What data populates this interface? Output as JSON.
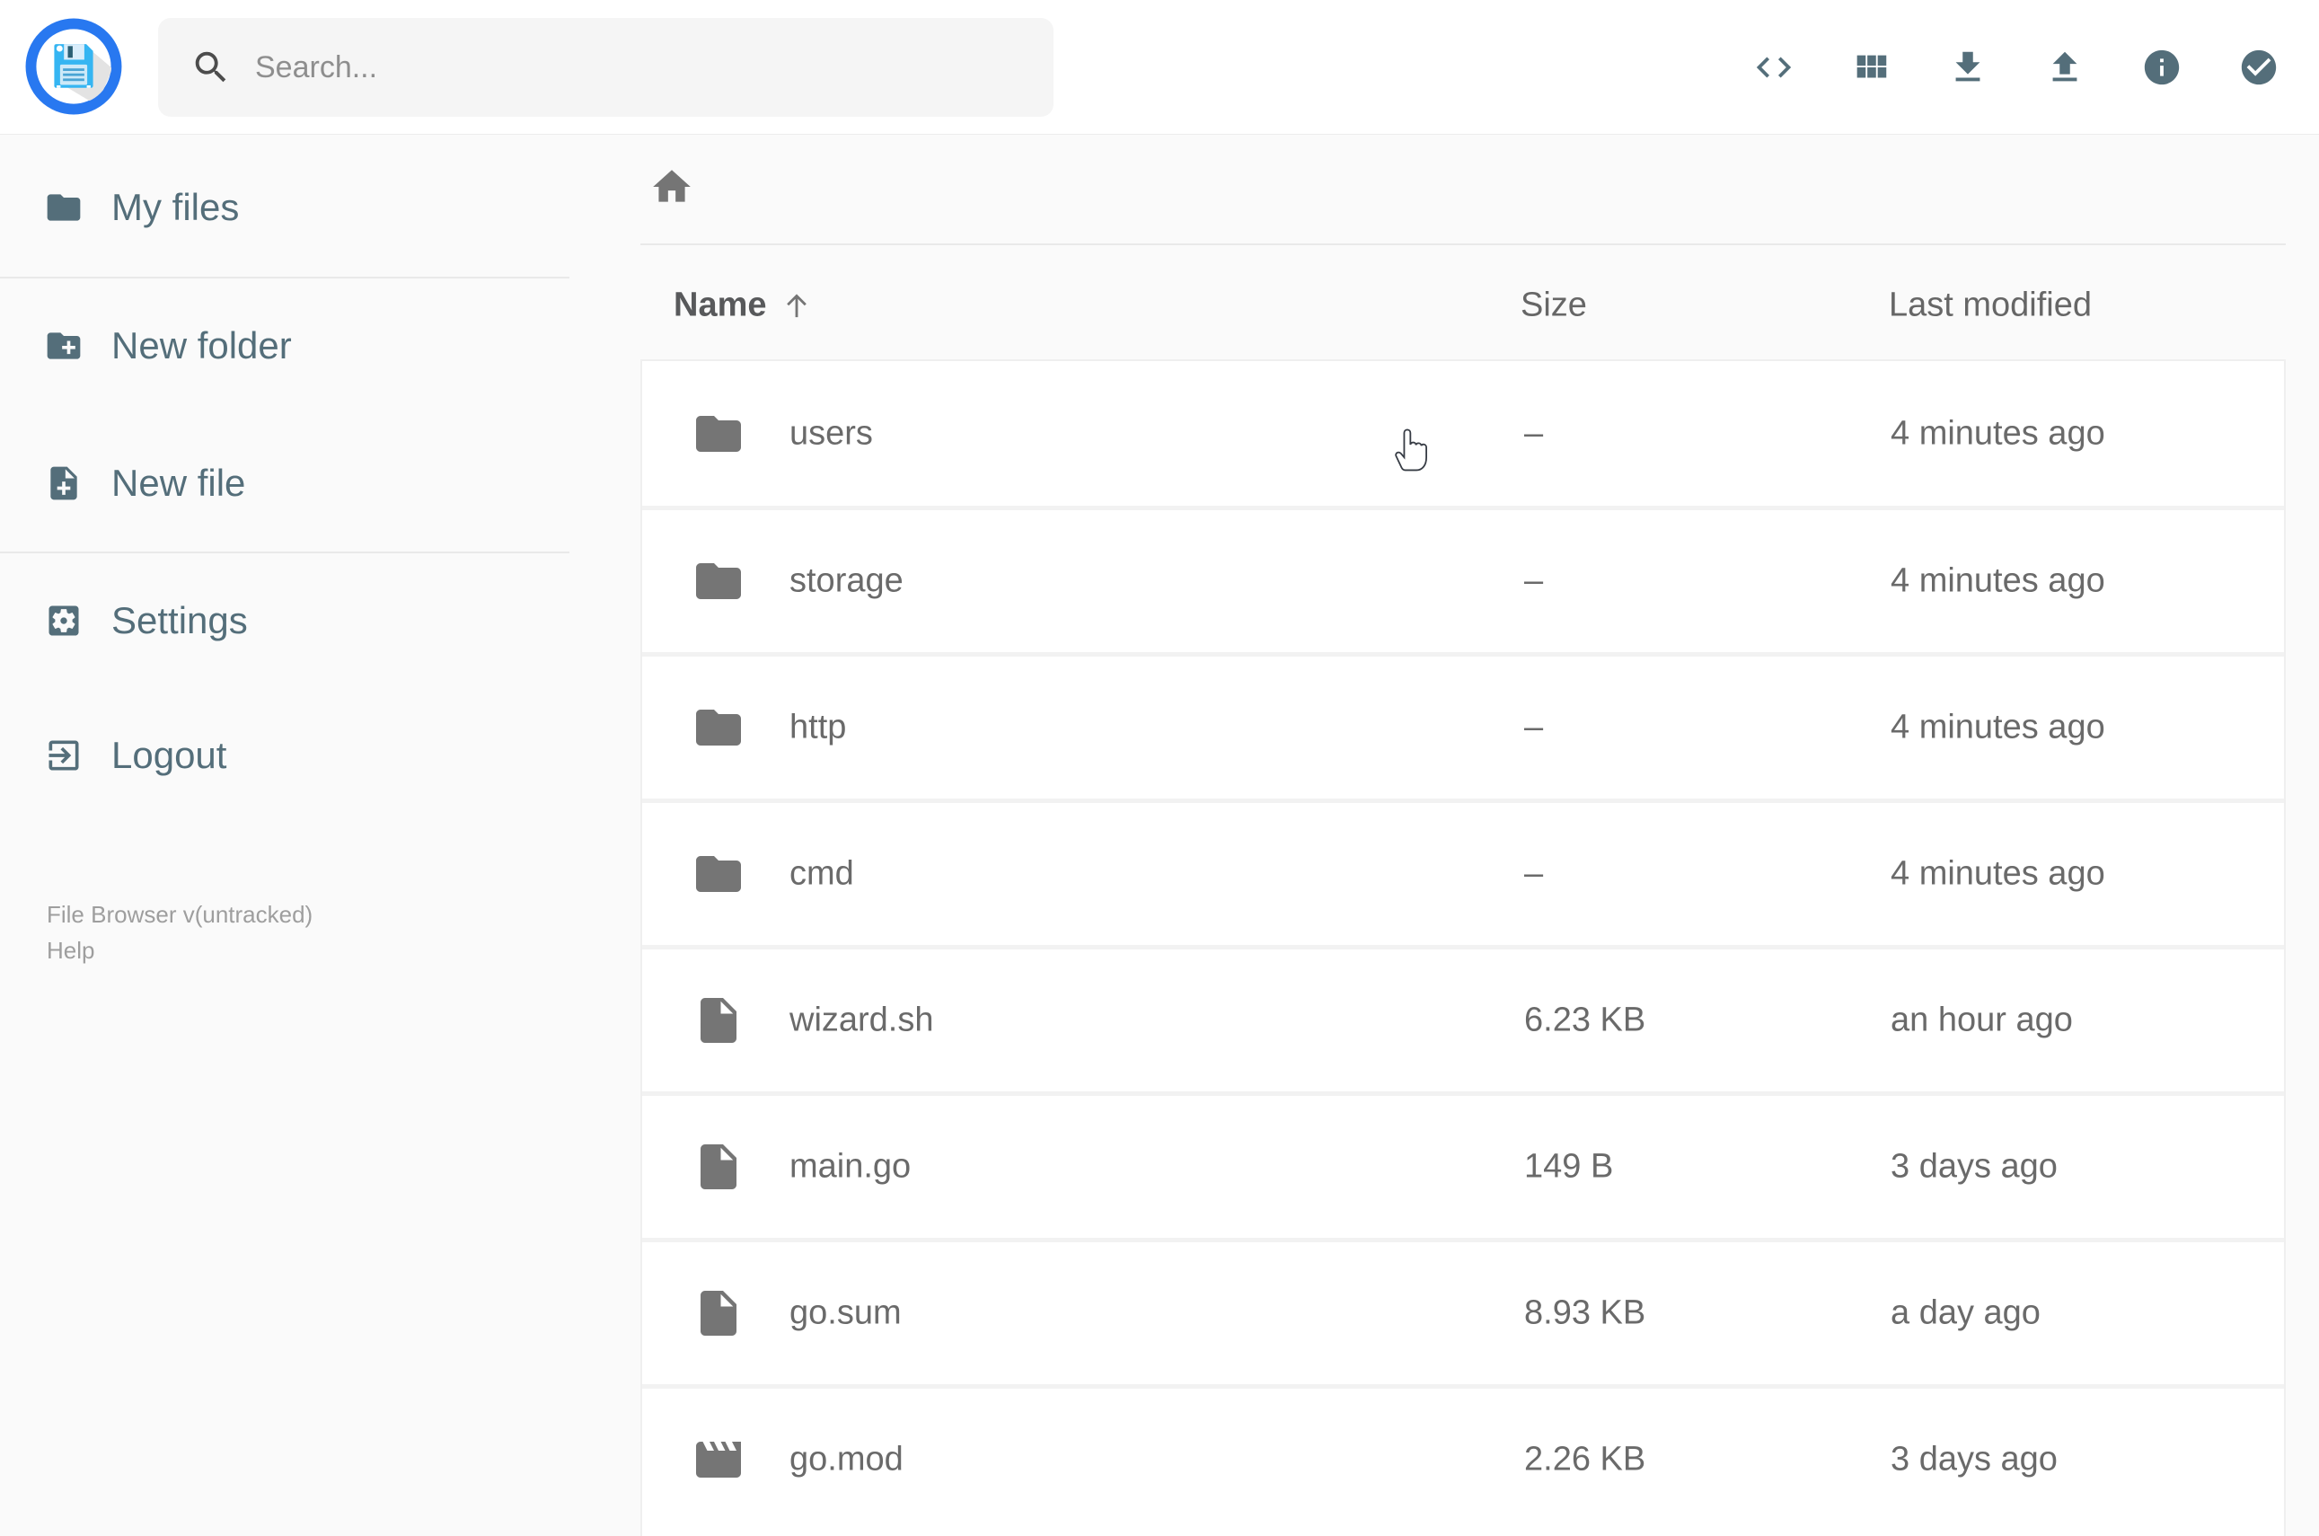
{
  "app": {
    "logo_icon": "floppy-disk-logo",
    "accent_blue": "#2878f0",
    "slate_color": "#546e7a",
    "icon_gray": "#757575"
  },
  "header": {
    "search_placeholder": "Search...",
    "search_icon": "search-icon",
    "toolbar_icons": [
      "code-icon",
      "grid-view-icon",
      "download-icon",
      "upload-icon",
      "info-icon",
      "check-circle-icon"
    ]
  },
  "sidebar": {
    "items": [
      {
        "label": "My files",
        "icon": "folder-icon"
      },
      {
        "label": "New folder",
        "icon": "create-folder-icon"
      },
      {
        "label": "New file",
        "icon": "create-file-icon"
      },
      {
        "label": "Settings",
        "icon": "settings-icon"
      },
      {
        "label": "Logout",
        "icon": "logout-icon"
      }
    ],
    "footer": {
      "version": "File Browser v(untracked)",
      "help": "Help"
    }
  },
  "breadcrumb": {
    "home_icon": "home-icon"
  },
  "listing": {
    "columns": [
      {
        "label": "Name",
        "sorted": "asc",
        "sort_icon": "arrow-up-icon"
      },
      {
        "label": "Size"
      },
      {
        "label": "Last modified"
      }
    ],
    "rows": [
      {
        "name": "users",
        "icon": "folder-icon",
        "size": "–",
        "modified": "4 minutes ago"
      },
      {
        "name": "storage",
        "icon": "folder-icon",
        "size": "–",
        "modified": "4 minutes ago"
      },
      {
        "name": "http",
        "icon": "folder-icon",
        "size": "–",
        "modified": "4 minutes ago"
      },
      {
        "name": "cmd",
        "icon": "folder-icon",
        "size": "–",
        "modified": "4 minutes ago"
      },
      {
        "name": "wizard.sh",
        "icon": "file-icon",
        "size": "6.23 KB",
        "modified": "an hour ago"
      },
      {
        "name": "main.go",
        "icon": "file-icon",
        "size": "149 B",
        "modified": "3 days ago"
      },
      {
        "name": "go.sum",
        "icon": "file-icon",
        "size": "8.93 KB",
        "modified": "a day ago"
      },
      {
        "name": "go.mod",
        "icon": "movie-icon",
        "size": "2.26 KB",
        "modified": "3 days ago"
      }
    ]
  },
  "cursor": {
    "icon": "hand-pointer-cursor"
  }
}
